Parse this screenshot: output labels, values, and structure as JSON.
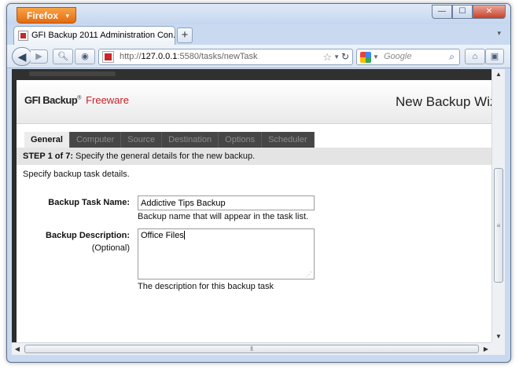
{
  "browser": {
    "menu_button": "Firefox",
    "menu_arrow": "▾",
    "window_controls": {
      "minimize": "—",
      "maximize": "☐",
      "close": "✕"
    },
    "tab_title": "GFI Backup 2011 Administration Con...",
    "new_tab": "+",
    "tab_list": "▾",
    "url_prefix": "http://",
    "url_host": "127.0.0.1",
    "url_path": ":5580/tasks/newTask",
    "search_placeholder": "Google",
    "icons": {
      "back": "back-arrow-icon",
      "forward": "forward-arrow-icon",
      "search": "magnifier-icon",
      "home": "home-icon",
      "bookmark": "star-icon",
      "reload": "reload-icon"
    }
  },
  "app": {
    "brand_prefix": "GFI",
    "brand_main": "Backup",
    "brand_suffix": "Freeware",
    "reg_mark": "®",
    "wizard_title": "New Backup Wiz",
    "tabs": [
      {
        "label": "General",
        "active": true
      },
      {
        "label": "Computer",
        "active": false
      },
      {
        "label": "Source",
        "active": false
      },
      {
        "label": "Destination",
        "active": false
      },
      {
        "label": "Options",
        "active": false
      },
      {
        "label": "Scheduler",
        "active": false
      }
    ],
    "step_prefix": "STEP 1 of 7:",
    "step_text": " Specify the general details for the new backup.",
    "intro": "Specify backup task details.",
    "form": {
      "name_label": "Backup Task Name:",
      "name_value": "Addictive Tips Backup",
      "name_hint": "Backup name that will appear in the task list.",
      "desc_label": "Backup Description:",
      "desc_optional": "(Optional)",
      "desc_value": "Office Files",
      "desc_hint": "The description for this backup task"
    }
  },
  "colors": {
    "brand_red": "#c61f26",
    "firefox_orange": "#e8781a",
    "tab_bar_dark": "#464646"
  }
}
